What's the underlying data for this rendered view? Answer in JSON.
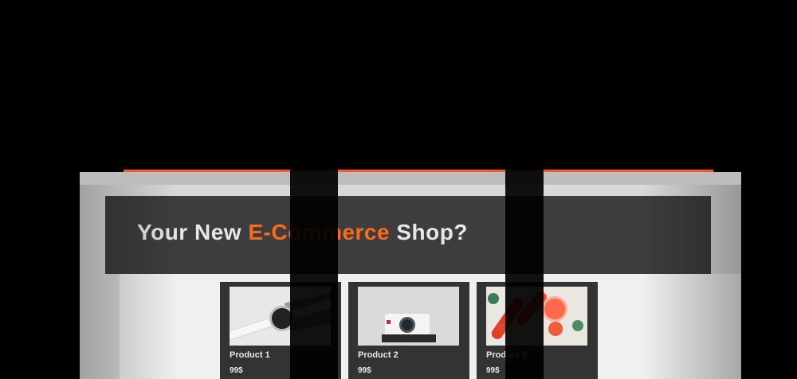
{
  "hero": {
    "title_prefix": "Your New ",
    "title_highlight": "E-Commerce",
    "title_suffix": " Shop?"
  },
  "products": [
    {
      "name": "Product 1",
      "price": "99$",
      "image": "smartwatch-image"
    },
    {
      "name": "Product 2",
      "price": "99$",
      "image": "instant-camera-image"
    },
    {
      "name": "Product 3",
      "price": "99$",
      "image": "grapefruit-cosmetics-image"
    }
  ],
  "colors": {
    "accent": "#ff6a1a",
    "hero_bg": "#3d3d3d",
    "card_bg": "#333333"
  }
}
